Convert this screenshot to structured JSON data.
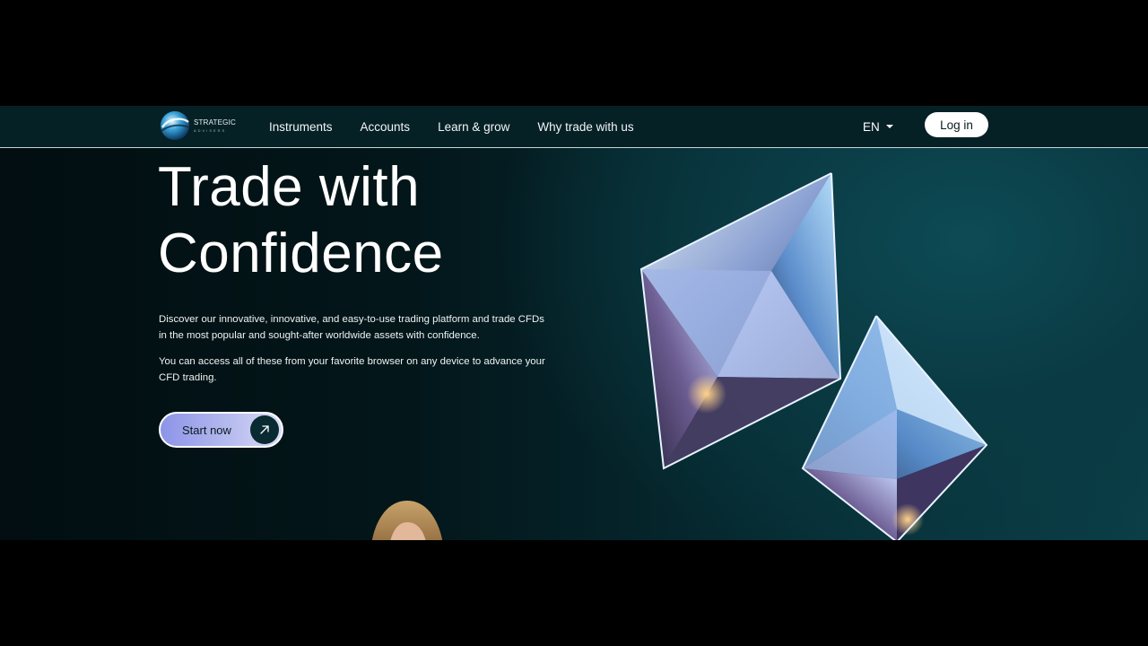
{
  "brand": {
    "name_line1": "STRATEGIC",
    "name_line2": "ADVISERS",
    "logo_icon": "globe-swirl-logo"
  },
  "nav": {
    "links": [
      {
        "label": "Instruments"
      },
      {
        "label": "Accounts"
      },
      {
        "label": "Learn & grow"
      },
      {
        "label": "Why trade with us"
      }
    ],
    "language": "EN",
    "language_icon": "chevron-down-icon",
    "login_label": "Log in"
  },
  "hero": {
    "title_line1": "Trade with",
    "title_line2": "Confidence",
    "paragraph1": "Discover our innovative, innovative, and easy-to-use trading platform and trade CFDs in the most popular and sought-after worldwide assets with confidence.",
    "paragraph2": "You can access all of these from your favorite browser on any device to advance your CFD trading.",
    "cta_label": "Start now",
    "cta_icon": "arrow-up-right-icon"
  },
  "colors": {
    "accent_gradient_start": "#8d94e8",
    "accent_gradient_end": "#d9dbf6",
    "nav_background": "#062126",
    "hero_teal": "#0b3f48"
  }
}
